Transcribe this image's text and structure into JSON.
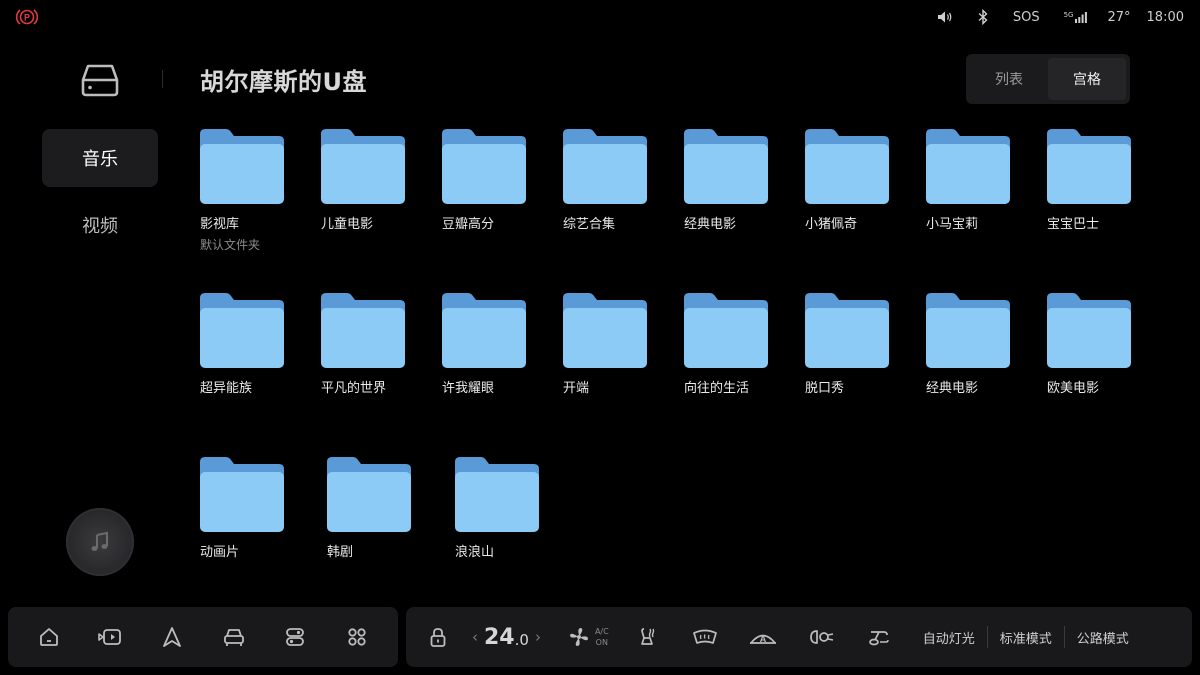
{
  "status": {
    "parking_label": "P",
    "sos": "SOS",
    "network": "5G",
    "temperature": "27°",
    "time": "18:00"
  },
  "sidebar": {
    "items": [
      {
        "label": "音乐",
        "active": true
      },
      {
        "label": "视频",
        "active": false
      }
    ]
  },
  "header": {
    "title": "胡尔摩斯的U盘",
    "view_options": [
      {
        "label": "列表",
        "active": false
      },
      {
        "label": "宫格",
        "active": true
      }
    ]
  },
  "folders": [
    {
      "name": "影视库",
      "sub": "默认文件夹"
    },
    {
      "name": "儿童电影"
    },
    {
      "name": "豆瓣高分"
    },
    {
      "name": "综艺合集"
    },
    {
      "name": "经典电影"
    },
    {
      "name": "小猪佩奇"
    },
    {
      "name": "小马宝莉"
    },
    {
      "name": "宝宝巴士"
    },
    {
      "name": "超异能族"
    },
    {
      "name": "平凡的世界"
    },
    {
      "name": "许我耀眼"
    },
    {
      "name": "开端"
    },
    {
      "name": "向往的生活"
    },
    {
      "name": "脱口秀"
    },
    {
      "name": "经典电影"
    },
    {
      "name": "欧美电影"
    },
    {
      "name": "动画片"
    },
    {
      "name": "韩剧"
    },
    {
      "name": "浪浪山"
    }
  ],
  "climate": {
    "temp_int": "24",
    "temp_dec": ".0",
    "ac_line1": "A/C",
    "ac_line2": "ON",
    "modes": [
      "自动灯光",
      "标准模式",
      "公路模式"
    ]
  },
  "colors": {
    "folder_back": "#5a9ad6",
    "folder_front": "#8ccbf6",
    "parking_red": "#e03a3a"
  }
}
